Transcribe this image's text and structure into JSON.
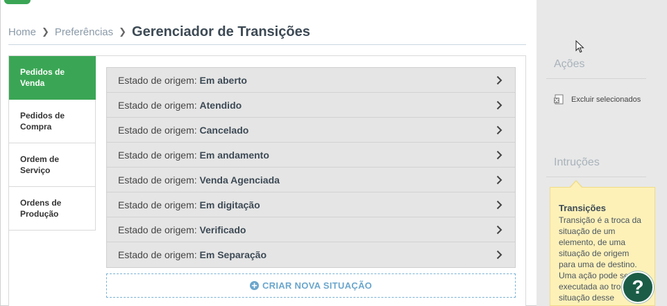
{
  "breadcrumb": {
    "home": "Home",
    "preferences": "Preferências",
    "current": "Gerenciador de Transições"
  },
  "side_tabs": [
    {
      "label": "Pedidos de Venda",
      "active": true
    },
    {
      "label": "Pedidos de Compra",
      "active": false
    },
    {
      "label": "Ordem de Serviço",
      "active": false
    },
    {
      "label": "Ordens de Produção",
      "active": false
    }
  ],
  "states": {
    "prefix": "Estado de origem:",
    "items": [
      "Em aberto",
      "Atendido",
      "Cancelado",
      "Em andamento",
      "Venda Agenciada",
      "Em digitação",
      "Verificado",
      "Em Separação"
    ]
  },
  "create_button": "CRIAR NOVA SITUAÇÃO",
  "sidebar": {
    "actions_title": "Ações",
    "delete_selected": "Excluir selecionados",
    "instructions_title": "Intruções",
    "tip_title": "Transições",
    "tip_text": "Transição é a troca da situação de um elemento, de uma situação de origem para uma de destino. Uma ação pode ser executada ao trocar a situação desse"
  },
  "help_label": "?",
  "icons": {
    "chevron": "chevron-right-icon",
    "add": "plus-circle-icon",
    "delete": "excel-delete-icon",
    "cursor": "mouse-cursor-icon"
  },
  "colors": {
    "accent": "#3aa655",
    "link": "#6ba6cc",
    "tip_bg": "#fdf1b8",
    "help_bg": "#1b5c47"
  }
}
